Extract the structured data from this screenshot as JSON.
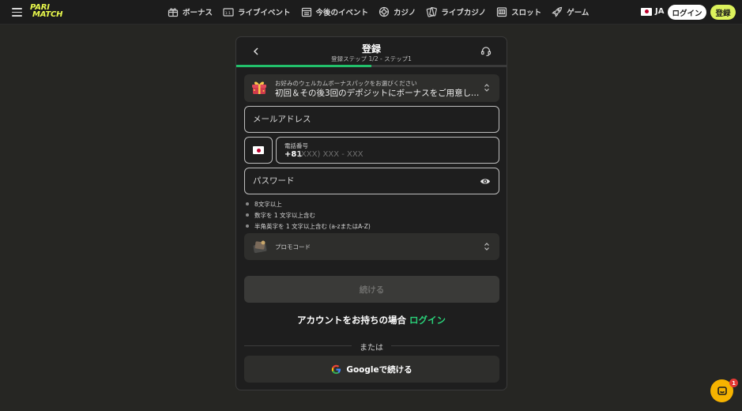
{
  "header": {
    "logo_line1": "PARI",
    "logo_line2": "MATCH",
    "nav": [
      {
        "label": "ボーナス",
        "icon": "gift-icon"
      },
      {
        "label": "ライブイベント",
        "icon": "live-tv-icon"
      },
      {
        "label": "今後のイベント",
        "icon": "calendar-icon"
      },
      {
        "label": "カジノ",
        "icon": "casino-chip-icon"
      },
      {
        "label": "ライブカジノ",
        "icon": "cards-icon"
      },
      {
        "label": "スロット",
        "icon": "slot-icon"
      },
      {
        "label": "ゲーム",
        "icon": "rocket-icon"
      }
    ],
    "language": "JA",
    "login_label": "ログイン",
    "register_label": "登録"
  },
  "modal": {
    "title": "登録",
    "subtitle": "登録ステップ 1/2 - ステップ1",
    "progress": 0.5,
    "bonus": {
      "label": "お好みのウェルカムボーナスパックをお選びください",
      "value": "初回＆その後3回のデポジットにボーナスをご用意しています"
    },
    "email_placeholder": "メールアドレス",
    "phone": {
      "label": "電話番号",
      "code": "+81",
      "mask": "(XXX) XXX - XXX"
    },
    "password_placeholder": "パスワード",
    "rules": [
      "8文字以上",
      "数字を 1 文字以上含む",
      "半角英字を 1 文字以上含む (a-zまたはA-Z)"
    ],
    "promo_label": "プロモコード",
    "continue_label": "続ける",
    "have_account_text": "アカウントをお持ちの場合",
    "login_link": "ログイン",
    "or_text": "または",
    "google_label": "Googleで続ける"
  },
  "chat": {
    "badge": "1"
  },
  "colors": {
    "accent_yellow": "#dcf25c",
    "accent_green": "#22c06b",
    "background": "#262623",
    "panel": "#1e1e1e"
  }
}
